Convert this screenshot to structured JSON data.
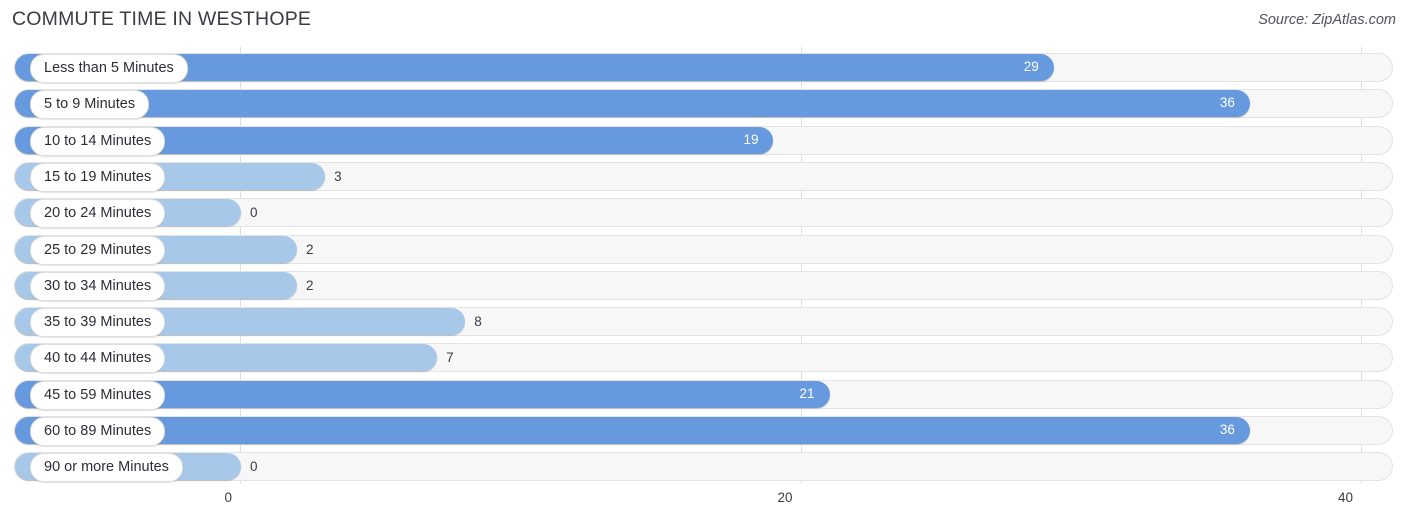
{
  "header": {
    "title": "COMMUTE TIME IN WESTHOPE",
    "source": "Source: ZipAtlas.com"
  },
  "colors": {
    "bar_high": "#6699dd",
    "bar_low": "#a8c8ea",
    "track": "#f7f7f7",
    "gridline": "#dedede",
    "text": "#3b3b44"
  },
  "chart_data": {
    "type": "bar",
    "orientation": "horizontal",
    "title": "COMMUTE TIME IN WESTHOPE",
    "xlabel": "",
    "ylabel": "",
    "xlim": [
      0,
      40
    ],
    "grid": true,
    "legend": false,
    "ticks": [
      "0",
      "20",
      "40"
    ],
    "tick_values": [
      0,
      20,
      40
    ],
    "categories": [
      "Less than 5 Minutes",
      "5 to 9 Minutes",
      "10 to 14 Minutes",
      "15 to 19 Minutes",
      "20 to 24 Minutes",
      "25 to 29 Minutes",
      "30 to 34 Minutes",
      "35 to 39 Minutes",
      "40 to 44 Minutes",
      "45 to 59 Minutes",
      "60 to 89 Minutes",
      "90 or more Minutes"
    ],
    "values": [
      29,
      36,
      19,
      3,
      0,
      2,
      2,
      8,
      7,
      21,
      36,
      0
    ],
    "value_labels": [
      "29",
      "36",
      "19",
      "3",
      "0",
      "2",
      "2",
      "8",
      "7",
      "21",
      "36",
      "0"
    ]
  }
}
